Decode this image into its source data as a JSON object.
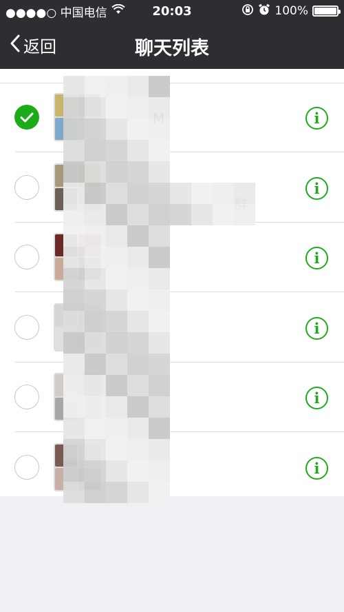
{
  "status_bar": {
    "carrier": "●●●●○ 中国电信",
    "time": "20:03",
    "battery_percent_label": "100%",
    "battery_level": 1.0,
    "icons": [
      "wifi-icon",
      "rotation-lock-icon",
      "alarm-icon",
      "battery-icon"
    ]
  },
  "nav": {
    "back_label": "返回",
    "title": "聊天列表"
  },
  "colors": {
    "bar_bg": "#2e2e32",
    "accent_green": "#1aad19",
    "list_bg": "#ffffff",
    "page_bg": "#efeff4",
    "separator": "#dcdcdc"
  },
  "list": {
    "items": [
      {
        "name": "M",
        "selected": true
      },
      {
        "name": "群",
        "selected": false
      },
      {
        "name": "",
        "selected": false
      },
      {
        "name": "",
        "selected": false
      },
      {
        "name": "",
        "selected": false
      },
      {
        "name": "",
        "selected": false
      }
    ]
  }
}
